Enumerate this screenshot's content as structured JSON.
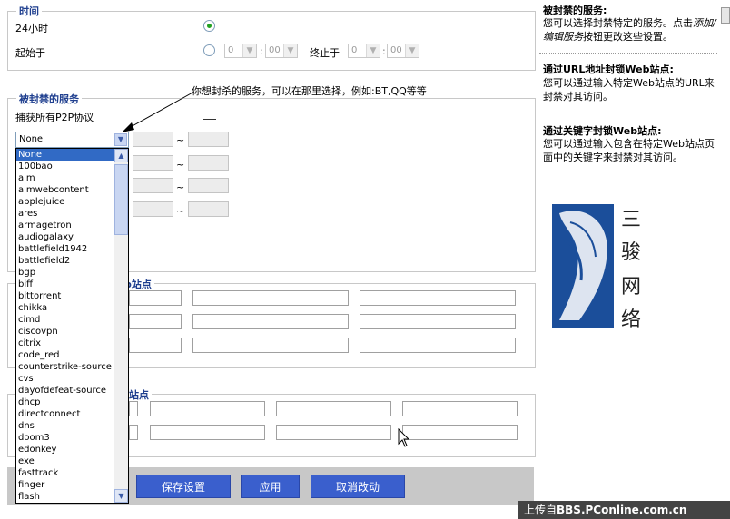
{
  "time_section": {
    "legend": "时间",
    "option_24h": "24小时",
    "option_start": "起始于",
    "start_hour": "0",
    "start_min": "00",
    "end_label": "终止于",
    "end_hour": "0",
    "end_min": "00"
  },
  "blocked_services": {
    "legend": "被封禁的服务",
    "p2p_label": "捕获所有P2P协议",
    "annotation": "你想封杀的服务，可以在那里选择，例如:BT,QQ等等",
    "selected": "None",
    "tilde": "~",
    "options": [
      "None",
      "100bao",
      "aim",
      "aimwebcontent",
      "applejuice",
      "ares",
      "armagetron",
      "audiogalaxy",
      "battlefield1942",
      "battlefield2",
      "bgp",
      "biff",
      "bittorrent",
      "chikka",
      "cimd",
      "ciscovpn",
      "citrix",
      "code_red",
      "counterstrike-source",
      "cvs",
      "dayofdefeat-source",
      "dhcp",
      "directconnect",
      "dns",
      "doom3",
      "edonkey",
      "exe",
      "fasttrack",
      "finger",
      "flash"
    ]
  },
  "url_block": {
    "legend_visible": "b站点"
  },
  "keyword_block": {
    "legend_visible": "站点"
  },
  "buttons": {
    "save": "保存设置",
    "apply": "应用",
    "cancel": "取消改动"
  },
  "sidebar": {
    "s1_title": "被封禁的服务:",
    "s1_text_a": "您可以选择封禁特定的服务。点击",
    "s1_text_link": "添加/编辑服务",
    "s1_text_b": "按钮更改这些设置。",
    "s2_title": "通过URL地址封锁Web站点:",
    "s2_text": "您可以通过输入特定Web站点的URL来封禁对其访问。",
    "s3_title": "通过关键字封锁Web站点:",
    "s3_text": "您可以通过输入包含在特定Web站点页面中的关键字来封禁对其访问。"
  },
  "logo": {
    "chars": [
      "三",
      "骏",
      "网",
      "络"
    ]
  },
  "watermark": {
    "prefix": "上传自",
    "site": "BBS.PConline.com.cn"
  },
  "colors": {
    "accent_blue": "#3a5fcd",
    "legend_blue": "#1f3f8f",
    "radio_green": "#21a121"
  }
}
